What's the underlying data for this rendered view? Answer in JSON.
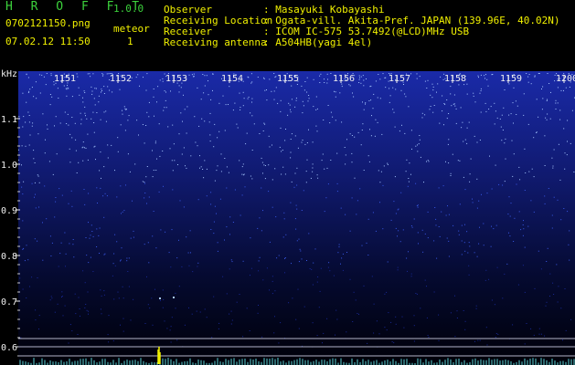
{
  "app": {
    "name": "H R O F F T",
    "version": "1.0.0"
  },
  "file": {
    "name": "0702121150.png",
    "datetime": "07.02.12 11:50"
  },
  "meteor": {
    "label": "meteor",
    "count": "1"
  },
  "info": [
    {
      "label": "Observer",
      "value": ": Masayuki Kobayashi"
    },
    {
      "label": "Receiving Location",
      "value": ": Ogata-vill. Akita-Pref. JAPAN (139.96E, 40.02N)"
    },
    {
      "label": "Receiver",
      "value": ": ICOM IC-575 53.7492(@LCD)MHz USB"
    },
    {
      "label": "Receiving antenna",
      "value": ": A504HB(yagi 4el)"
    }
  ],
  "colors": {
    "header_text": "#f0f000",
    "title": "#3cd23c",
    "axis": "#e8e8e8",
    "noise": "#1e2cc8",
    "echo": "#f0f000"
  },
  "spectrogram": {
    "unit": "kHz",
    "time_ticks": [
      "1151",
      "1152",
      "1153",
      "1154",
      "1155",
      "1156",
      "1157",
      "1158",
      "1159",
      "1200"
    ],
    "freq_ticks": [
      "1.1",
      "1.0",
      "0.9",
      "0.8",
      "0.7",
      "0.6"
    ]
  }
}
